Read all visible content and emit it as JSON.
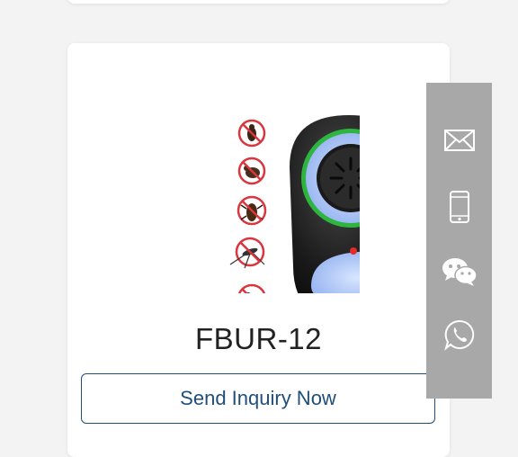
{
  "product": {
    "title": "FBUR-12",
    "image_alt": "ultrasonic-pest-repeller-icon"
  },
  "actions": {
    "inquiry_label": "Send Inquiry Now"
  },
  "side_bar": {
    "items": [
      {
        "name": "email-icon"
      },
      {
        "name": "phone-icon"
      },
      {
        "name": "wechat-icon"
      },
      {
        "name": "whatsapp-icon"
      }
    ]
  },
  "colors": {
    "accent": "#1f4e7a",
    "sidebar": "#a8a8a8",
    "glow": "#2ecc40"
  }
}
